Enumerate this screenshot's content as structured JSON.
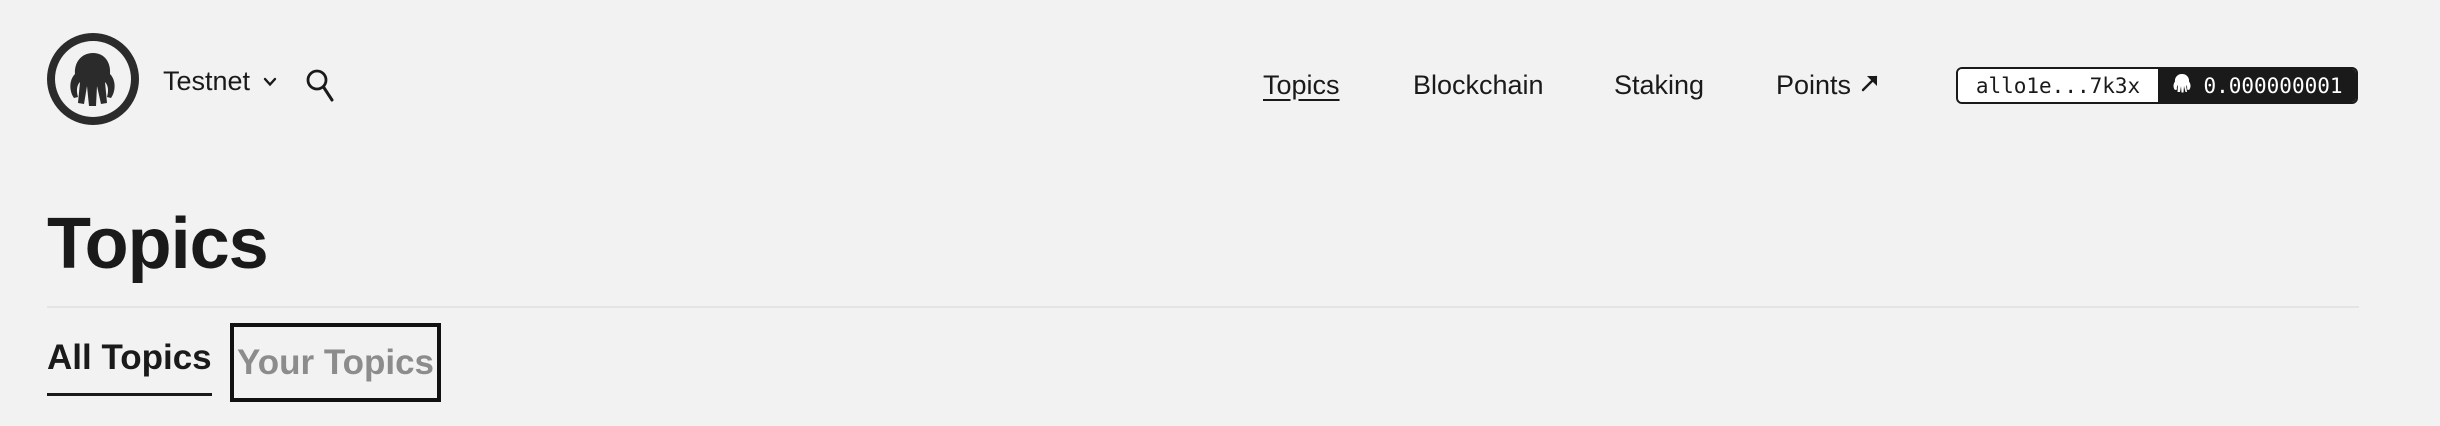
{
  "header": {
    "logo_icon": "allora-logo-icon",
    "network": {
      "label": "Testnet",
      "icon": "chevron-down-icon"
    },
    "search_icon": "search-icon",
    "nav": [
      {
        "label": "Topics",
        "active": true
      },
      {
        "label": "Blockchain",
        "active": false
      },
      {
        "label": "Staking",
        "active": false
      },
      {
        "label": "Points",
        "external": true,
        "icon": "arrow-up-right-icon"
      }
    ],
    "wallet": {
      "address": "allo1e...7k3x",
      "balance": "0.000000001",
      "token_icon": "allora-token-icon"
    }
  },
  "page": {
    "title": "Topics",
    "tabs": [
      {
        "label": "All Topics",
        "active": true
      },
      {
        "label": "Your Topics",
        "active": false,
        "focused": true
      }
    ]
  },
  "colors": {
    "background": "#f2f2f2",
    "text": "#1a1a1a",
    "inactive_tab": "#8c8c8c",
    "wallet_dark": "#1a1a1a",
    "wallet_light": "#ffffff"
  }
}
